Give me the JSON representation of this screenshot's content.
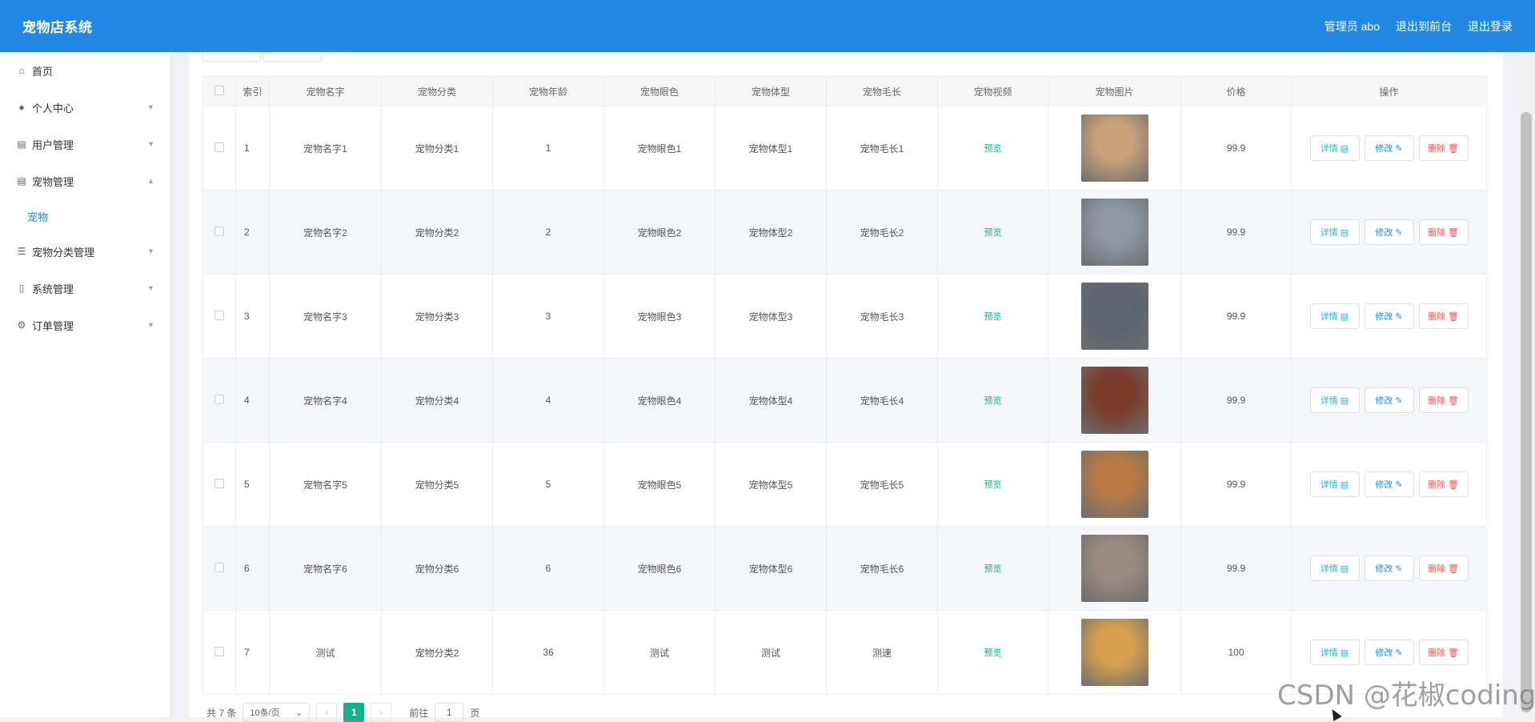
{
  "app": {
    "title": "宠物店系统"
  },
  "header": {
    "admin_label": "管理员 abo",
    "to_front": "退出到前台",
    "logout": "退出登录"
  },
  "sidebar": {
    "items": [
      {
        "label": "首页",
        "icon": "home-icon",
        "chevron": ""
      },
      {
        "label": "个人中心",
        "icon": "user-icon",
        "chevron": "▾"
      },
      {
        "label": "用户管理",
        "icon": "clipboard-icon",
        "chevron": "▾"
      },
      {
        "label": "宠物管理",
        "icon": "clipboard-icon",
        "chevron": "▴"
      },
      {
        "label": "宠物分类管理",
        "icon": "list-icon",
        "chevron": "▾"
      },
      {
        "label": "系统管理",
        "icon": "lock-icon",
        "chevron": "▾"
      },
      {
        "label": "订单管理",
        "icon": "settings-icon",
        "chevron": "▾"
      }
    ],
    "submenu": {
      "label": "宠物"
    }
  },
  "table": {
    "headers": [
      "索引",
      "宠物名字",
      "宠物分类",
      "宠物年龄",
      "宠物眼色",
      "宠物体型",
      "宠物毛长",
      "宠物视频",
      "宠物图片",
      "价格",
      "操作"
    ],
    "rows": [
      {
        "index": "1",
        "name": "宠物名字1",
        "category": "宠物分类1",
        "age": "1",
        "eye": "宠物眼色1",
        "size": "宠物体型1",
        "fur": "宠物毛长1",
        "video": "预览",
        "price": "99.9"
      },
      {
        "index": "2",
        "name": "宠物名字2",
        "category": "宠物分类2",
        "age": "2",
        "eye": "宠物眼色2",
        "size": "宠物体型2",
        "fur": "宠物毛长2",
        "video": "预览",
        "price": "99.9"
      },
      {
        "index": "3",
        "name": "宠物名字3",
        "category": "宠物分类3",
        "age": "3",
        "eye": "宠物眼色3",
        "size": "宠物体型3",
        "fur": "宠物毛长3",
        "video": "预览",
        "price": "99.9"
      },
      {
        "index": "4",
        "name": "宠物名字4",
        "category": "宠物分类4",
        "age": "4",
        "eye": "宠物眼色4",
        "size": "宠物体型4",
        "fur": "宠物毛长4",
        "video": "预览",
        "price": "99.9"
      },
      {
        "index": "5",
        "name": "宠物名字5",
        "category": "宠物分类5",
        "age": "5",
        "eye": "宠物眼色5",
        "size": "宠物体型5",
        "fur": "宠物毛长5",
        "video": "预览",
        "price": "99.9"
      },
      {
        "index": "6",
        "name": "宠物名字6",
        "category": "宠物分类6",
        "age": "6",
        "eye": "宠物眼色6",
        "size": "宠物体型6",
        "fur": "宠物毛长6",
        "video": "预览",
        "price": "99.9"
      },
      {
        "index": "7",
        "name": "测试",
        "category": "宠物分类2",
        "age": "36",
        "eye": "测试",
        "size": "测试",
        "fur": "测速",
        "video": "预览",
        "price": "100"
      }
    ],
    "photo_colors": [
      "#c9a27a",
      "#8e97a3",
      "#5b6470",
      "#7a3b2a",
      "#b87a45",
      "#9a8a82",
      "#d6a04f"
    ],
    "actions": {
      "detail": "详情",
      "edit": "修改",
      "delete": "删除"
    }
  },
  "pagination": {
    "total": "共 7 条",
    "page_size": "10条/页",
    "current": "1",
    "goto_prefix": "前往",
    "goto_value": "1",
    "goto_suffix": "页"
  },
  "watermark": "CSDN @花椒coding",
  "colors": {
    "header": "#2388e3",
    "accent_green": "#13b28c",
    "danger": "#f05656",
    "info": "#21b4c9"
  }
}
